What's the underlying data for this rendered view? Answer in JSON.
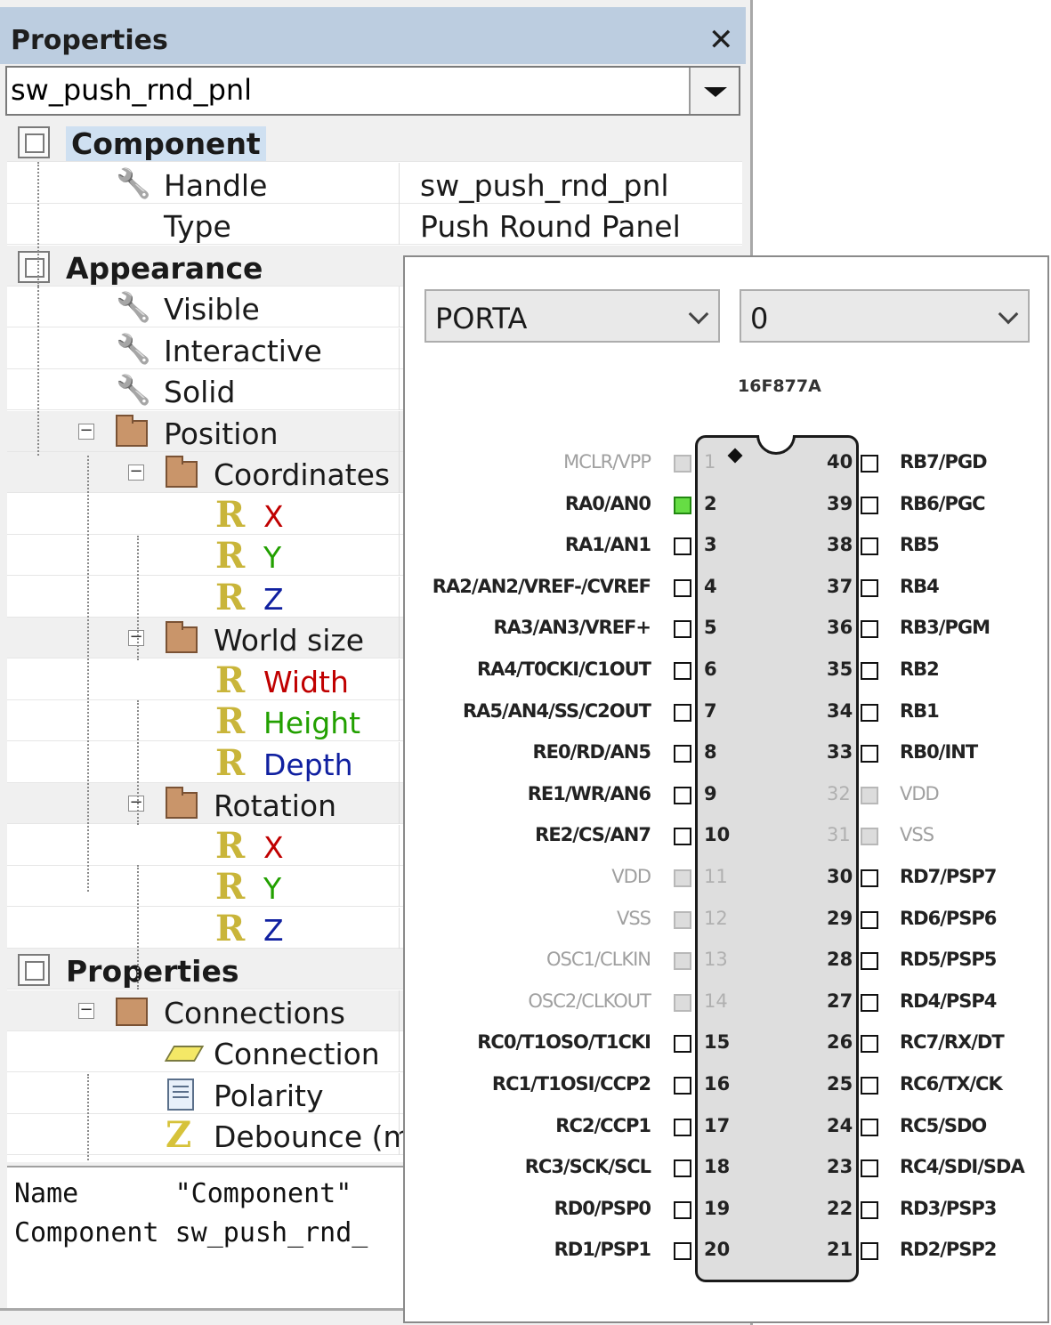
{
  "panel": {
    "title": "Properties",
    "selector_value": "sw_push_rnd_pnl"
  },
  "rows": [
    {
      "name": "Component",
      "level": 0,
      "kind": "category",
      "selected": true
    },
    {
      "name": "Handle",
      "value": "sw_push_rnd_pnl",
      "level": 1,
      "icon": "wrench"
    },
    {
      "name": "Type",
      "value": "Push Round Panel",
      "level": 1,
      "icon": "none"
    },
    {
      "name": "Appearance",
      "level": 0,
      "kind": "category"
    },
    {
      "name": "Visible",
      "level": 1,
      "icon": "wrench"
    },
    {
      "name": "Interactive",
      "level": 1,
      "icon": "wrench"
    },
    {
      "name": "Solid",
      "level": 1,
      "icon": "wrench"
    },
    {
      "name": "Position",
      "level": 1,
      "icon": "folder",
      "expanded": true
    },
    {
      "name": "Coordinates",
      "level": 2,
      "icon": "folder",
      "expanded": true
    },
    {
      "name": "X",
      "level": 3,
      "icon": "real",
      "color": "#c00000"
    },
    {
      "name": "Y",
      "level": 3,
      "icon": "real",
      "color": "#22a000"
    },
    {
      "name": "Z",
      "level": 3,
      "icon": "real",
      "color": "#1020a0"
    },
    {
      "name": "World size",
      "level": 2,
      "icon": "folder",
      "expanded": true
    },
    {
      "name": "Width",
      "level": 3,
      "icon": "real",
      "color": "#c00000"
    },
    {
      "name": "Height",
      "level": 3,
      "icon": "real",
      "color": "#22a000"
    },
    {
      "name": "Depth",
      "level": 3,
      "icon": "real",
      "color": "#1020a0"
    },
    {
      "name": "Rotation",
      "level": 2,
      "icon": "folder",
      "expanded": true
    },
    {
      "name": "X",
      "level": 3,
      "icon": "real",
      "color": "#c00000"
    },
    {
      "name": "Y",
      "level": 3,
      "icon": "real",
      "color": "#22a000"
    },
    {
      "name": "Z",
      "level": 3,
      "icon": "real",
      "color": "#1020a0"
    },
    {
      "name": "Properties",
      "level": 0,
      "kind": "category"
    },
    {
      "name": "Connections",
      "level": 1,
      "icon": "connections",
      "expanded": true
    },
    {
      "name": "Connection",
      "level": 2,
      "icon": "parallelogram"
    },
    {
      "name": "Polarity",
      "level": 2,
      "icon": "list"
    },
    {
      "name": "Debounce (ms)",
      "level": 2,
      "icon": "integer"
    }
  ],
  "description": {
    "line1": "Name      \"Component\"",
    "line2": "Component sw_push_rnd_"
  },
  "chip_popup": {
    "port_select": "PORTA",
    "bit_select": "0",
    "chip_name": "16F877A",
    "left_pins": [
      {
        "num": "1",
        "name": "MCLR/VPP",
        "state": "disabled"
      },
      {
        "num": "2",
        "name": "RA0/AN0",
        "state": "selected"
      },
      {
        "num": "3",
        "name": "RA1/AN1",
        "state": "normal"
      },
      {
        "num": "4",
        "name": "RA2/AN2/VREF-/CVREF",
        "state": "normal"
      },
      {
        "num": "5",
        "name": "RA3/AN3/VREF+",
        "state": "normal"
      },
      {
        "num": "6",
        "name": "RA4/T0CKI/C1OUT",
        "state": "normal"
      },
      {
        "num": "7",
        "name": "RA5/AN4/SS/C2OUT",
        "state": "normal"
      },
      {
        "num": "8",
        "name": "RE0/RD/AN5",
        "state": "normal"
      },
      {
        "num": "9",
        "name": "RE1/WR/AN6",
        "state": "normal"
      },
      {
        "num": "10",
        "name": "RE2/CS/AN7",
        "state": "normal"
      },
      {
        "num": "11",
        "name": "VDD",
        "state": "disabled"
      },
      {
        "num": "12",
        "name": "VSS",
        "state": "disabled"
      },
      {
        "num": "13",
        "name": "OSC1/CLKIN",
        "state": "disabled"
      },
      {
        "num": "14",
        "name": "OSC2/CLKOUT",
        "state": "disabled"
      },
      {
        "num": "15",
        "name": "RC0/T1OSO/T1CKI",
        "state": "normal"
      },
      {
        "num": "16",
        "name": "RC1/T1OSI/CCP2",
        "state": "normal"
      },
      {
        "num": "17",
        "name": "RC2/CCP1",
        "state": "normal"
      },
      {
        "num": "18",
        "name": "RC3/SCK/SCL",
        "state": "normal"
      },
      {
        "num": "19",
        "name": "RD0/PSP0",
        "state": "normal"
      },
      {
        "num": "20",
        "name": "RD1/PSP1",
        "state": "normal"
      }
    ],
    "right_pins": [
      {
        "num": "40",
        "name": "RB7/PGD",
        "state": "normal"
      },
      {
        "num": "39",
        "name": "RB6/PGC",
        "state": "normal"
      },
      {
        "num": "38",
        "name": "RB5",
        "state": "normal"
      },
      {
        "num": "37",
        "name": "RB4",
        "state": "normal"
      },
      {
        "num": "36",
        "name": "RB3/PGM",
        "state": "normal"
      },
      {
        "num": "35",
        "name": "RB2",
        "state": "normal"
      },
      {
        "num": "34",
        "name": "RB1",
        "state": "normal"
      },
      {
        "num": "33",
        "name": "RB0/INT",
        "state": "normal"
      },
      {
        "num": "32",
        "name": "VDD",
        "state": "disabled"
      },
      {
        "num": "31",
        "name": "VSS",
        "state": "disabled"
      },
      {
        "num": "30",
        "name": "RD7/PSP7",
        "state": "normal"
      },
      {
        "num": "29",
        "name": "RD6/PSP6",
        "state": "normal"
      },
      {
        "num": "28",
        "name": "RD5/PSP5",
        "state": "normal"
      },
      {
        "num": "27",
        "name": "RD4/PSP4",
        "state": "normal"
      },
      {
        "num": "26",
        "name": "RC7/RX/DT",
        "state": "normal"
      },
      {
        "num": "25",
        "name": "RC6/TX/CK",
        "state": "normal"
      },
      {
        "num": "24",
        "name": "RC5/SDO",
        "state": "normal"
      },
      {
        "num": "23",
        "name": "RC4/SDI/SDA",
        "state": "normal"
      },
      {
        "num": "22",
        "name": "RD3/PSP3",
        "state": "normal"
      },
      {
        "num": "21",
        "name": "RD2/PSP2",
        "state": "normal"
      }
    ]
  }
}
